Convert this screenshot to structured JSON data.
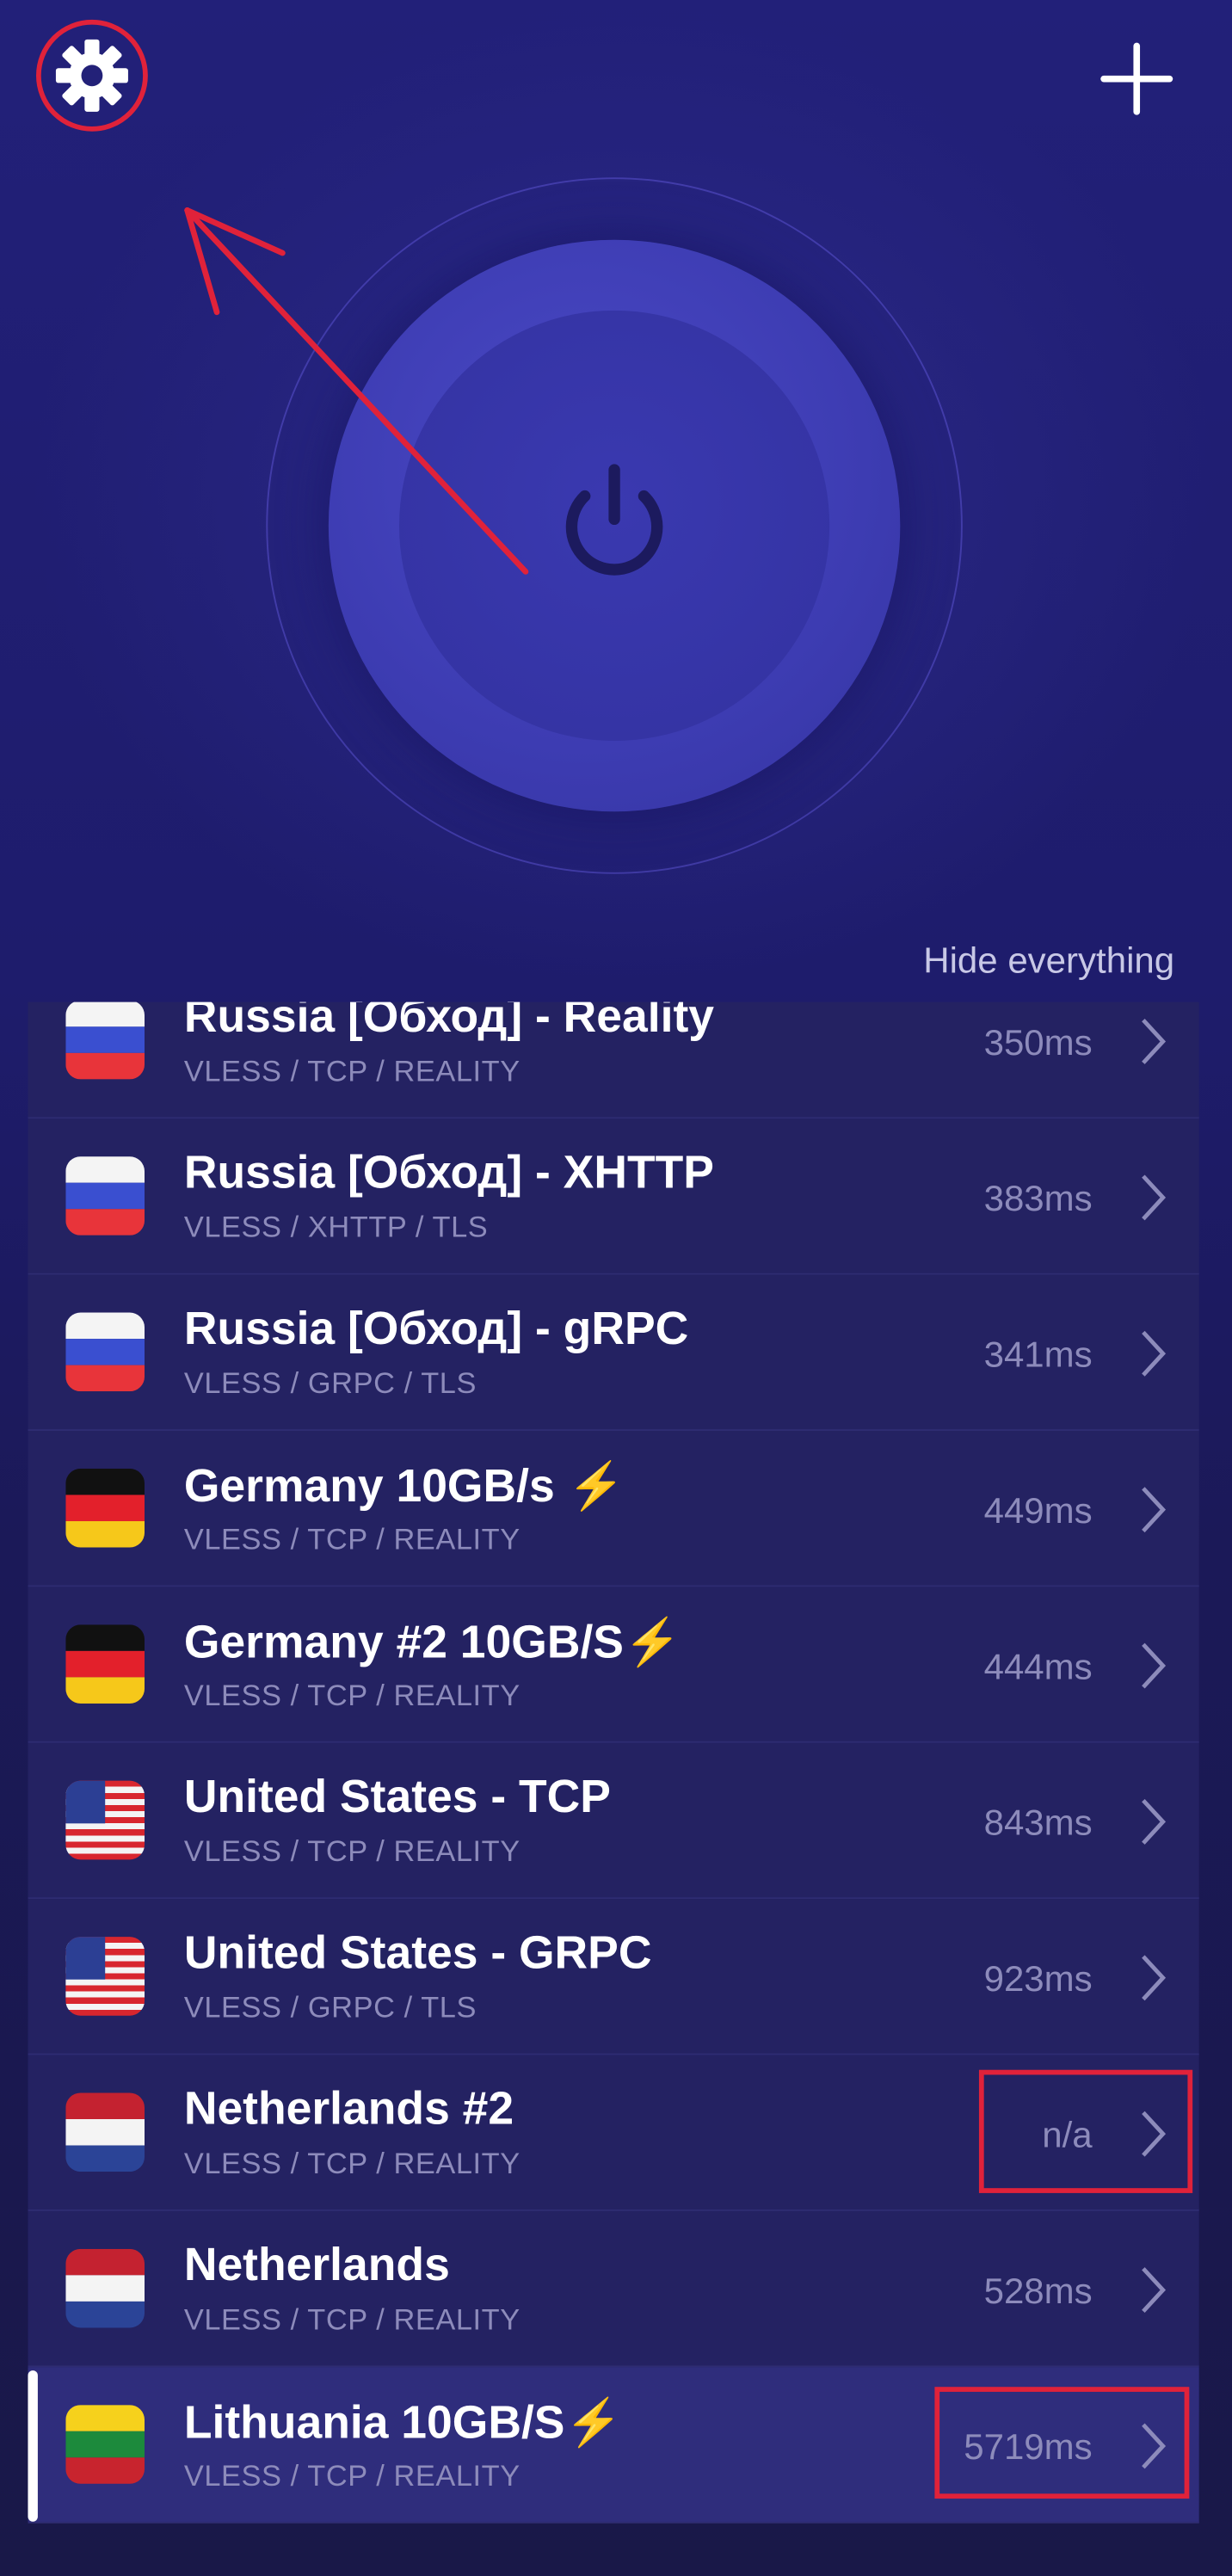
{
  "header": {
    "settings_icon": "gear-icon",
    "add_icon": "plus-icon",
    "power_icon": "power-icon"
  },
  "hide_everything": "Hide everything",
  "colors": {
    "accent_red": "#e0223a",
    "background": "#1e1c6c"
  },
  "servers": [
    {
      "name": "Russia [Обход] - Reality",
      "protocol": "VLESS / TCP / REALITY",
      "ping": "350ms",
      "flag": "ru"
    },
    {
      "name": "Russia [Обход] - XHTTP",
      "protocol": "VLESS / XHTTP / TLS",
      "ping": "383ms",
      "flag": "ru"
    },
    {
      "name": "Russia [Обход] - gRPC",
      "protocol": "VLESS / GRPC / TLS",
      "ping": "341ms",
      "flag": "ru"
    },
    {
      "name": "Germany 10GB/s ⚡",
      "protocol": "VLESS / TCP / REALITY",
      "ping": "449ms",
      "flag": "de"
    },
    {
      "name": "Germany #2 10GB/S⚡",
      "protocol": "VLESS / TCP / REALITY",
      "ping": "444ms",
      "flag": "de"
    },
    {
      "name": "United States - TCP",
      "protocol": "VLESS / TCP / REALITY",
      "ping": "843ms",
      "flag": "us"
    },
    {
      "name": "United States - GRPC",
      "protocol": "VLESS / GRPC / TLS",
      "ping": "923ms",
      "flag": "us"
    },
    {
      "name": "Netherlands #2",
      "protocol": "VLESS / TCP / REALITY",
      "ping": "n/a",
      "flag": "nl"
    },
    {
      "name": "Netherlands",
      "protocol": "VLESS / TCP / REALITY",
      "ping": "528ms",
      "flag": "nl"
    },
    {
      "name": "Lithuania 10GB/S⚡",
      "protocol": "VLESS / TCP / REALITY",
      "ping": "5719ms",
      "flag": "lt",
      "selected": true
    }
  ]
}
